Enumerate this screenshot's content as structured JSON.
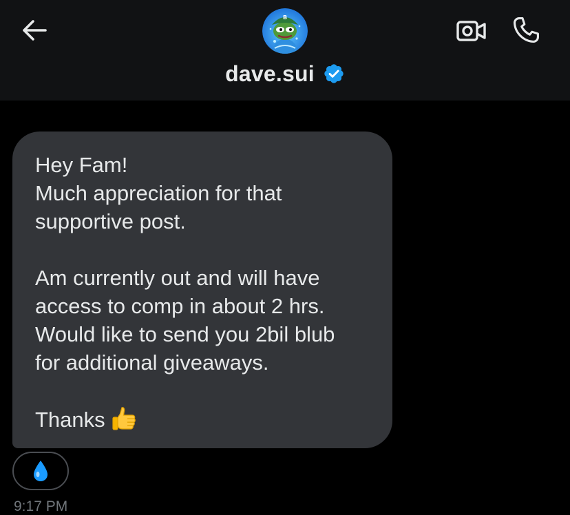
{
  "header": {
    "handle": "dave.sui",
    "verified": true,
    "back_icon": "arrow-left-icon",
    "video_icon": "video-camera-icon",
    "call_icon": "phone-icon",
    "background": "#111214"
  },
  "message": {
    "lines": [
      "Hey Fam!",
      "Much appreciation for that",
      "supportive post.",
      "",
      "Am currently out and will have",
      "access to comp in about 2 hrs.",
      "Would like to send you 2bil blub",
      "for additional giveaways.",
      "",
      "Thanks"
    ],
    "emoji_icon": "thumbs-up-icon",
    "bubble_color": "#333539"
  },
  "reaction": {
    "emoji_icon": "droplet-icon"
  },
  "timestamp": "9:17 PM",
  "colors": {
    "text": "#e7e9ea",
    "muted": "#71767b",
    "verified": "#1d9bf0",
    "background": "#000000"
  }
}
